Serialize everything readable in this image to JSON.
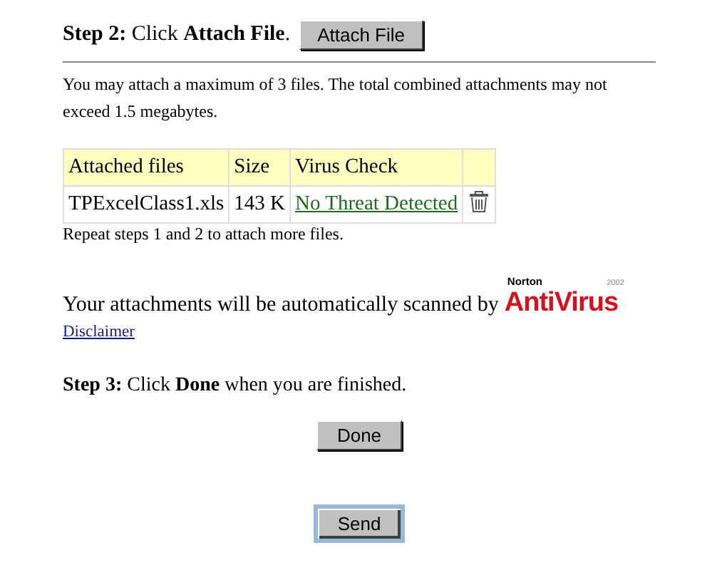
{
  "step2": {
    "label": "Step 2:",
    "text": "Click **Attach File**.",
    "button": "Attach File"
  },
  "limits_note": "You may attach a maximum of 3 files. The total combined attachments may not exceed 1.5 megabytes.",
  "table": {
    "columns": [
      "Attached files",
      "Size",
      "Virus Check"
    ],
    "rows": [
      {
        "file": "TPExcelClass1.xls",
        "size": "143 K",
        "virus_check": "No Threat Detected"
      }
    ]
  },
  "repeat_note": "Repeat steps 1 and 2 to attach more files.",
  "scan_note": "Your attachments will be automatically scanned by",
  "logo": {
    "brand": "Norton",
    "product": "AntiVirus",
    "year": "2002"
  },
  "disclaimer": "Disclaimer",
  "step3": {
    "label": "Step 3:",
    "text": "Click **Done** when you are finished."
  },
  "buttons": [
    {
      "label": "Done",
      "focused": false
    },
    {
      "label": "Send",
      "focused": true
    }
  ]
}
